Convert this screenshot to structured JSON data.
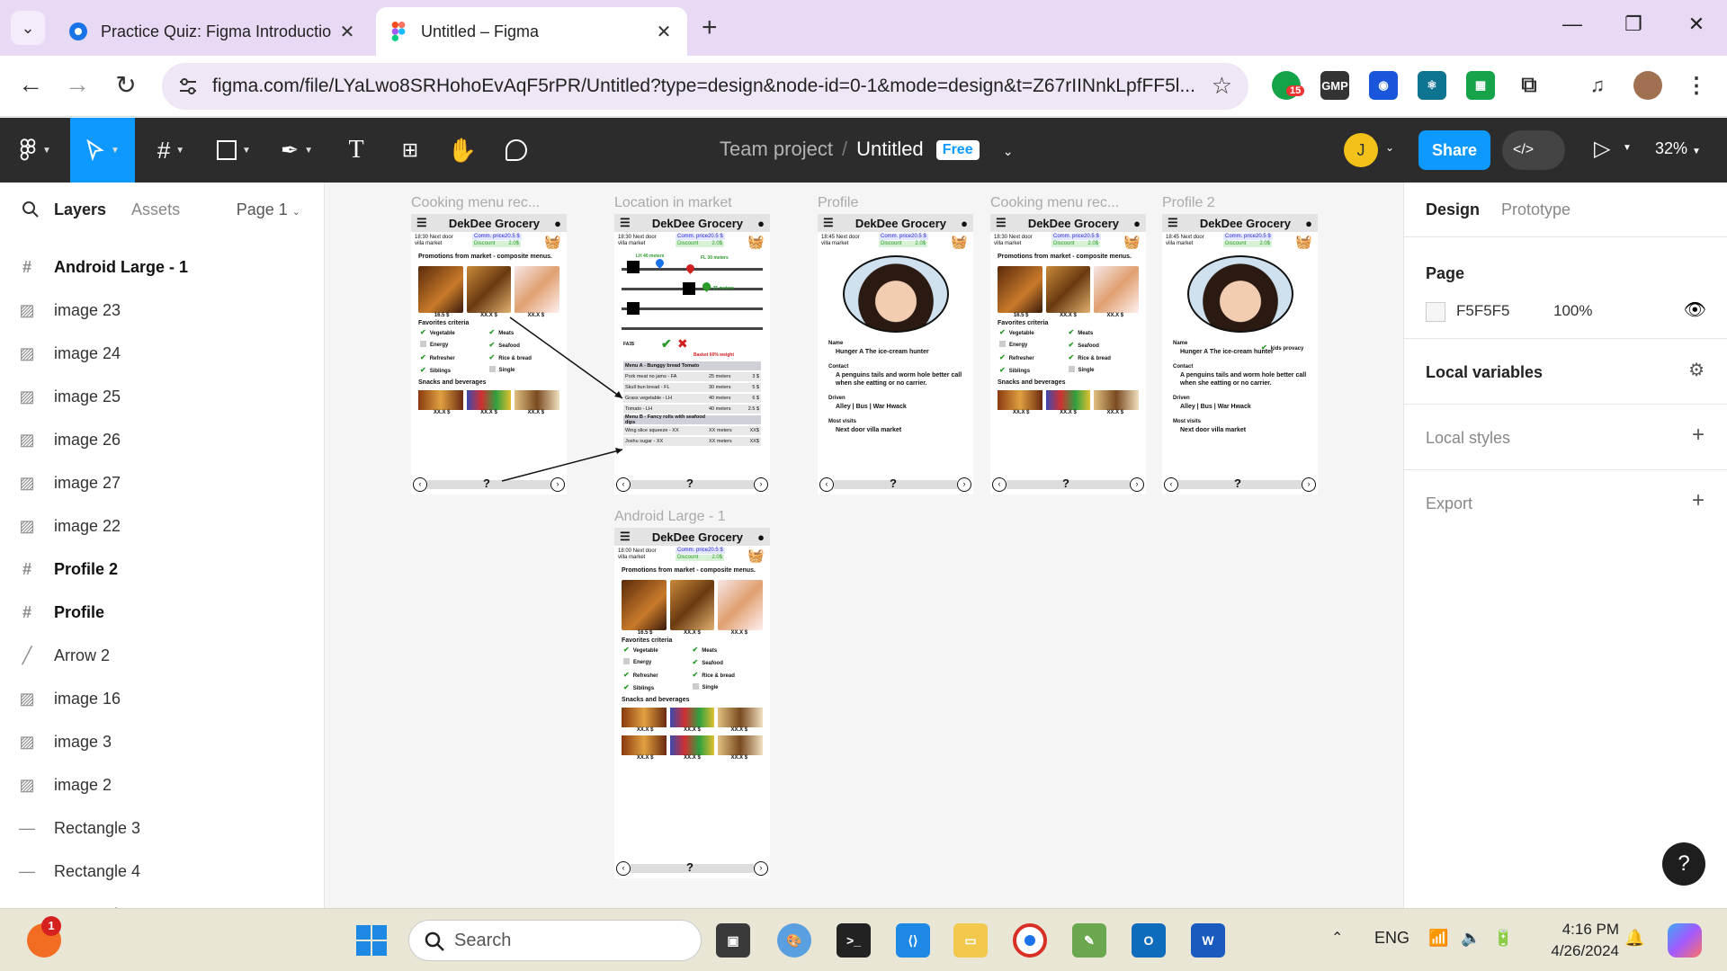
{
  "browser": {
    "tabs": [
      {
        "title": "Practice Quiz: Figma Introductio"
      },
      {
        "title": "Untitled – Figma"
      }
    ],
    "url": "figma.com/file/LYaLwo8SRHohoEvAqF5rPR/Untitled?type=design&node-id=0-1&mode=design&t=Z67rIINnkLpfFF5l...",
    "extensions": [
      {
        "name": "grammarly-icon",
        "badge": "15",
        "color": "#15a34a"
      },
      {
        "name": "GMP",
        "color": "#333333"
      },
      {
        "name": "camera-icon",
        "color": "#1a56db"
      },
      {
        "name": "react-icon",
        "color": "#0e7490"
      },
      {
        "name": "sheets-icon",
        "color": "#16a34a"
      }
    ]
  },
  "figma": {
    "team": "Team project",
    "file": "Untitled",
    "plan": "Free",
    "avatar_initial": "J",
    "share_label": "Share",
    "zoom": "32%"
  },
  "left_panel": {
    "tab_layers": "Layers",
    "tab_assets": "Assets",
    "page": "Page 1",
    "layers": [
      {
        "icon": "frame-icon",
        "name": "Android Large - 1",
        "bold": true
      },
      {
        "icon": "image-icon",
        "name": "image 23"
      },
      {
        "icon": "image-icon",
        "name": "image 24"
      },
      {
        "icon": "image-icon",
        "name": "image 25"
      },
      {
        "icon": "image-icon",
        "name": "image 26"
      },
      {
        "icon": "image-icon",
        "name": "image 27"
      },
      {
        "icon": "image-icon",
        "name": "image 22"
      },
      {
        "icon": "frame-icon",
        "name": "Profile 2",
        "bold": true
      },
      {
        "icon": "frame-icon",
        "name": "Profile",
        "bold": true
      },
      {
        "icon": "arrow-icon",
        "name": "Arrow 2"
      },
      {
        "icon": "image-icon",
        "name": "image 16"
      },
      {
        "icon": "image-icon",
        "name": "image 3"
      },
      {
        "icon": "image-icon",
        "name": "image 2"
      },
      {
        "icon": "rectangle-icon",
        "name": "Rectangle 3"
      },
      {
        "icon": "rectangle-icon",
        "name": "Rectangle 4"
      },
      {
        "icon": "rectangle-icon",
        "name": "Rectangle 1"
      }
    ]
  },
  "right_panel": {
    "tab_design": "Design",
    "tab_prototype": "Prototype",
    "page_label": "Page",
    "page_color": "F5F5F5",
    "page_opacity": "100%",
    "local_variables": "Local variables",
    "local_styles": "Local styles",
    "export": "Export",
    "help": "?"
  },
  "canvas": {
    "labels": {
      "cooking1": "Cooking menu rec...",
      "location": "Location in market",
      "profile": "Profile",
      "cooking2": "Cooking menu rec...",
      "profile2": "Profile 2",
      "android": "Android Large - 1"
    },
    "app": {
      "name": "DekDee Grocery",
      "time_loc_a": "18:30 Next door villa market",
      "time_loc_b": "18:45 Next door villa market",
      "time_loc_c": "18:00 Next door villa market",
      "comm_price": "Comm. price20.5 $",
      "discount": "Discount",
      "discount_val": "2.0$",
      "promo": "Promotions from market - composite menus.",
      "price_first": "16.5 $",
      "price_x": "XX.X $",
      "fav_criteria": "Favorites criteria",
      "criteria": [
        "Vegetable",
        "Meats",
        "Energy",
        "Seafood",
        "Refresher",
        "Rice & bread",
        "Siblings",
        "Single"
      ],
      "snacks": "Snacks and beverages",
      "q": "?"
    },
    "location": {
      "lh": "LH 40 meters",
      "fl": "FL 30 meters",
      "fa": "FA 25 meters",
      "fa3": "FA3$",
      "basket": "Basket 60% weight",
      "rows": [
        {
          "n": "Menu A - Bunggy bread Tomato",
          "m": "",
          "p": "",
          "menu": true
        },
        {
          "n": "Pork meat no jams - FA",
          "m": "25 meters",
          "p": "3 $"
        },
        {
          "n": "Skull bun bread - FL",
          "m": "30 meters",
          "p": "5 $"
        },
        {
          "n": "Grass vegetable - LH",
          "m": "40 meters",
          "p": "6 $"
        },
        {
          "n": "Tomato - LH",
          "m": "40 meters",
          "p": "2.5 $"
        },
        {
          "n": "Menu B - Fancy rolls with seafood dips",
          "m": "",
          "p": "",
          "menu": true
        },
        {
          "n": "Wing slice squeeze - XX",
          "m": "XX meters",
          "p": "XX$"
        },
        {
          "n": "Joshu sugar - XX",
          "m": "XX meters",
          "p": "XX$"
        }
      ]
    },
    "profile": {
      "name_lbl": "Name",
      "name": "Hunger A The ice-cream hunter",
      "contact_lbl": "Contact",
      "contact": "A penguins tails and worm hole better call when she eatting or no carrier.",
      "driven_lbl": "Driven",
      "driven": "Alley | Bus | War Hwack",
      "visits_lbl": "Most visits",
      "visits": "Next door villa market",
      "privacy": "kids provacy"
    }
  },
  "taskbar": {
    "search_placeholder": "Search",
    "lang": "ENG",
    "time": "4:16 PM",
    "date": "4/26/2024",
    "notif_count": "1"
  }
}
